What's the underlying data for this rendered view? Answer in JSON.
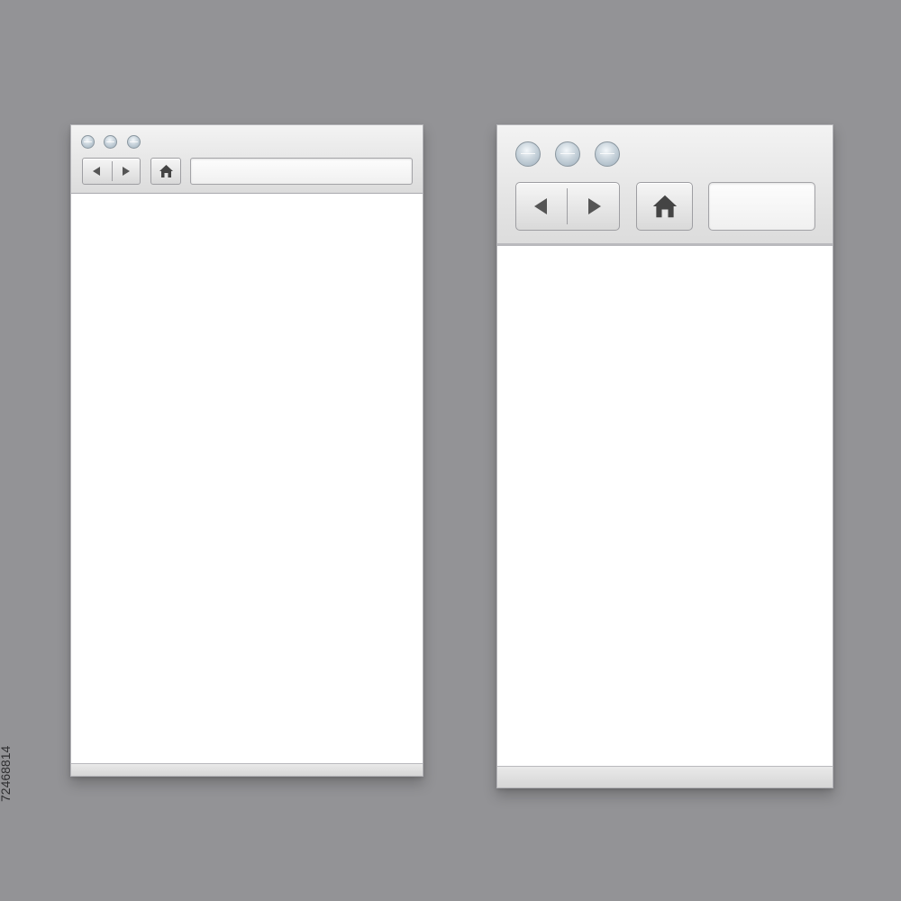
{
  "background_color": "#939396",
  "windows": [
    {
      "name": "small-browser-window",
      "traffic_lights": [
        "window-dot",
        "window-dot",
        "window-dot"
      ],
      "buttons": {
        "back_icon": "left-arrow-icon",
        "forward_icon": "right-arrow-icon",
        "home_icon": "home-icon"
      },
      "address_bar": {
        "value": "",
        "placeholder": ""
      }
    },
    {
      "name": "large-browser-window",
      "traffic_lights": [
        "window-dot",
        "window-dot",
        "window-dot"
      ],
      "buttons": {
        "back_icon": "left-arrow-icon",
        "forward_icon": "right-arrow-icon",
        "home_icon": "home-icon"
      },
      "address_bar": {
        "value": "",
        "placeholder": ""
      }
    }
  ],
  "image_id_text": "72468814",
  "colors": {
    "window_chrome": "#e6e6e6",
    "content": "#ffffff",
    "dot_accent": "#c9d4dc"
  }
}
